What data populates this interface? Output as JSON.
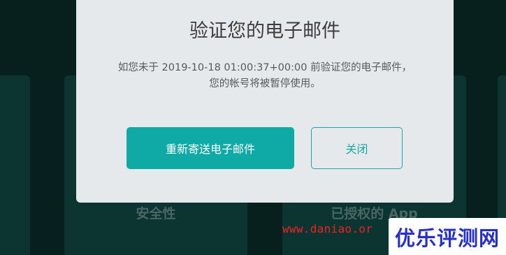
{
  "background": {
    "cards": [
      {
        "label": ""
      },
      {
        "label": "安全性"
      },
      {
        "label": "已授权的 App"
      },
      {
        "label": ""
      }
    ]
  },
  "dialog": {
    "title": "验证您的电子邮件",
    "message_line1": "如您未于 2019-10-18 01:00:37+00:00 前验证您的电子邮件，",
    "message_line2": "您的帐号将被暂停使用。",
    "resend_button": "重新寄送电子邮件",
    "close_button": "关闭"
  },
  "watermark": {
    "url": "www.daniao.or",
    "logo_text": "优乐评测网"
  },
  "colors": {
    "backdrop": "#07201d",
    "card": "#0c3531",
    "modal": "#e6e9eb",
    "accent": "#10aaa6",
    "watermark_red": "#ee2222",
    "watermark_blue": "#2630c9"
  }
}
